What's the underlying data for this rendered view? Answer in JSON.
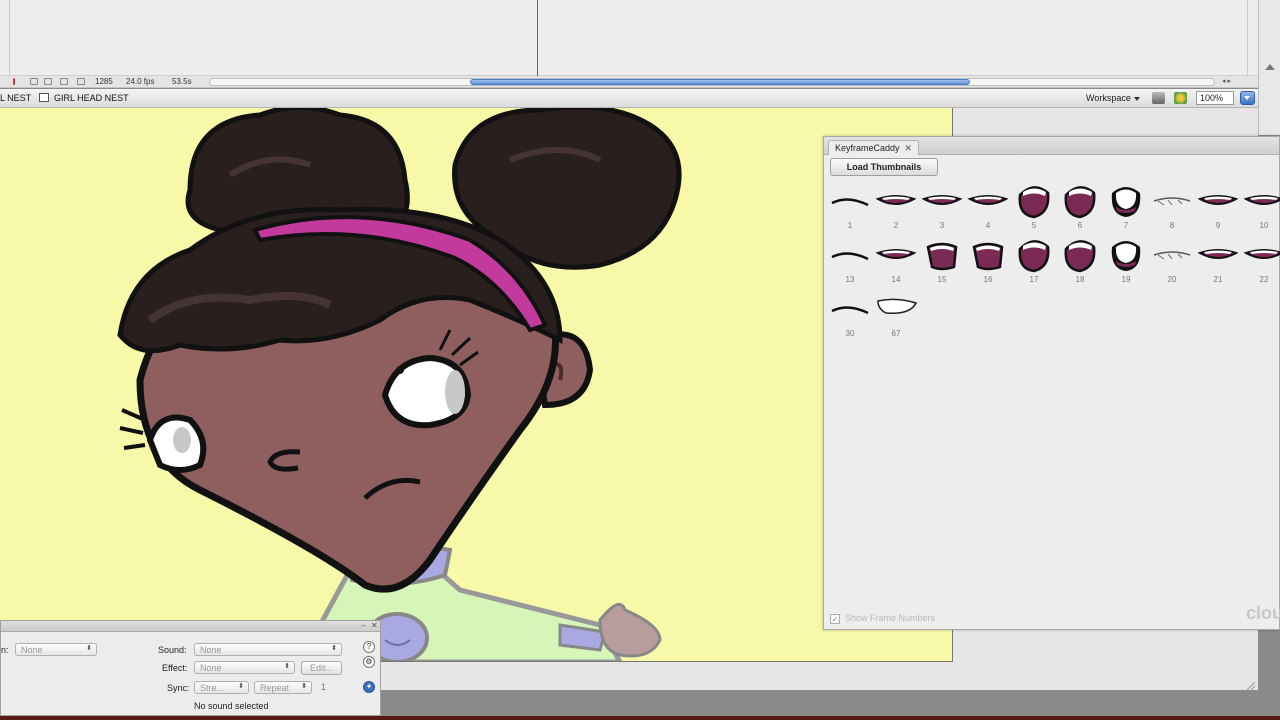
{
  "timeline": {
    "frame": "1285",
    "fps": "24.0 fps",
    "time": "53.5s"
  },
  "editbar": {
    "crumb_left": "L NEST",
    "crumb_right": "GIRL HEAD NEST",
    "workspace": "Workspace",
    "zoom": "100%"
  },
  "caddy": {
    "tab": "KeyframeCaddy",
    "load_button": "Load Thumbnails",
    "show_frame_numbers": "Show Frame Numbers",
    "watermark": "clou",
    "thumbnails": [
      {
        "num": "1",
        "shape": "line"
      },
      {
        "num": "2",
        "shape": "thin"
      },
      {
        "num": "3",
        "shape": "thin"
      },
      {
        "num": "4",
        "shape": "thin"
      },
      {
        "num": "5",
        "shape": "open"
      },
      {
        "num": "6",
        "shape": "open"
      },
      {
        "num": "7",
        "shape": "wide"
      },
      {
        "num": "8",
        "shape": "lash"
      },
      {
        "num": "9",
        "shape": "thin"
      },
      {
        "num": "10",
        "shape": "thin"
      },
      {
        "num": "13",
        "shape": "line"
      },
      {
        "num": "14",
        "shape": "thin"
      },
      {
        "num": "15",
        "shape": "half"
      },
      {
        "num": "16",
        "shape": "half"
      },
      {
        "num": "17",
        "shape": "open"
      },
      {
        "num": "18",
        "shape": "open"
      },
      {
        "num": "19",
        "shape": "wide"
      },
      {
        "num": "20",
        "shape": "lash"
      },
      {
        "num": "21",
        "shape": "thin"
      },
      {
        "num": "22",
        "shape": "thin"
      },
      {
        "num": "30",
        "shape": "line"
      },
      {
        "num": "67",
        "shape": "white"
      }
    ]
  },
  "properties": {
    "name_label": "n:",
    "name_value": "None",
    "sound_label": "Sound:",
    "sound_value": "None",
    "effect_label": "Effect:",
    "effect_value": "None",
    "edit_button": "Edit...",
    "sync_label": "Sync:",
    "sync_value": "Stre...",
    "repeat_value": "Repeat",
    "repeat_count": "1",
    "status": "No sound selected"
  },
  "colors": {
    "stage": "#f7f9a8",
    "skin": "#8f5f60",
    "hair": "#2a1f1f",
    "headband": "#c13a9c",
    "mouth_fill": "#7a2a55"
  }
}
